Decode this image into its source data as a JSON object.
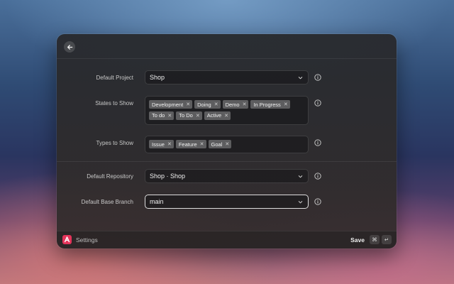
{
  "window": {
    "footer": {
      "title": "Settings",
      "save_label": "Save",
      "shortcut_keys": [
        "⌘",
        "↵"
      ]
    },
    "fields": {
      "default_project": {
        "label": "Default Project",
        "value": "Shop"
      },
      "states_to_show": {
        "label": "States to Show",
        "tags": [
          "Development",
          "Doing",
          "Demo",
          "In Progress",
          "To do",
          "To Do",
          "Active"
        ]
      },
      "types_to_show": {
        "label": "Types to Show",
        "tags": [
          "Issue",
          "Feature",
          "Goal"
        ]
      },
      "default_repository": {
        "label": "Default Repository",
        "value": "Shop · Shop"
      },
      "default_base_branch": {
        "label": "Default Base Branch",
        "value": "main"
      }
    }
  },
  "icons": {
    "back": "arrow-left-icon",
    "chevron": "chevron-down-icon",
    "info": "info-icon",
    "remove": "close-icon",
    "app": "app-logo-icon"
  },
  "colors": {
    "accent": "#e3345a",
    "tag_background": "#5d5d5f"
  }
}
